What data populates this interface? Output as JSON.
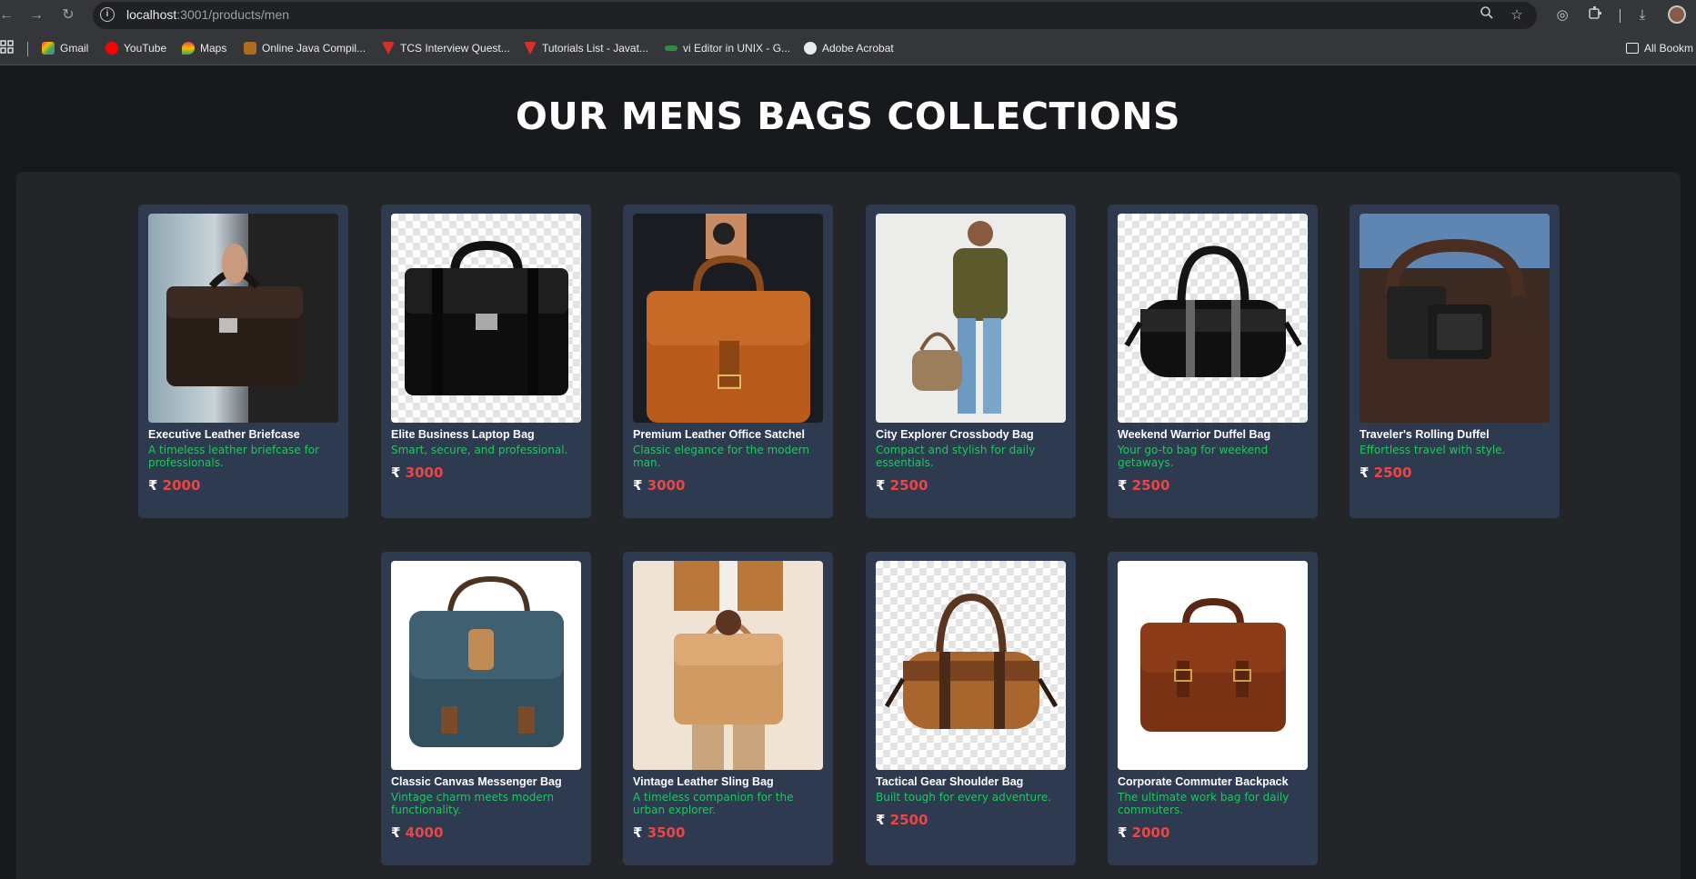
{
  "browser": {
    "url_host": "localhost",
    "url_rest": ":3001/products/men",
    "bookmarks": [
      {
        "label": "Gmail",
        "color": "#ea4335"
      },
      {
        "label": "YouTube",
        "color": "#ff0000"
      },
      {
        "label": "Maps",
        "color": "#34a853"
      },
      {
        "label": "Online Java Compil...",
        "color": "#f29900"
      },
      {
        "label": "TCS Interview Quest...",
        "color": "#d93025"
      },
      {
        "label": "Tutorials List - Javat...",
        "color": "#d93025"
      },
      {
        "label": "vi Editor in UNIX - G...",
        "color": "#2f8d46"
      },
      {
        "label": "Adobe Acrobat",
        "color": "#e8eaed"
      }
    ],
    "all_bookmarks": "All Bookm"
  },
  "page": {
    "title": "OUR MENS BAGS COLLECTIONS",
    "currency": "₹"
  },
  "products": [
    {
      "name": "Executive Leather Briefcase",
      "description": "A timeless leather briefcase for professionals.",
      "price": "2000"
    },
    {
      "name": "Elite Business Laptop Bag",
      "description": "Smart, secure, and professional.",
      "price": "3000"
    },
    {
      "name": "Premium Leather Office Satchel",
      "description": "Classic elegance for the modern man.",
      "price": "3000"
    },
    {
      "name": "City Explorer Crossbody Bag",
      "description": "Compact and stylish for daily essentials.",
      "price": "2500"
    },
    {
      "name": "Weekend Warrior Duffel Bag",
      "description": "Your go-to bag for weekend getaways.",
      "price": "2500"
    },
    {
      "name": "Traveler's Rolling Duffel",
      "description": "Effortless travel with style.",
      "price": "2500"
    },
    {
      "name": "Classic Canvas Messenger Bag",
      "description": "Vintage charm meets modern functionality.",
      "price": "4000"
    },
    {
      "name": "Vintage Leather Sling Bag",
      "description": "A timeless companion for the urban explorer.",
      "price": "3500"
    },
    {
      "name": "Tactical Gear Shoulder Bag",
      "description": "Built tough for every adventure.",
      "price": "2500"
    },
    {
      "name": "Corporate Commuter Backpack",
      "description": "The ultimate work bag for daily commuters.",
      "price": "2000"
    }
  ]
}
